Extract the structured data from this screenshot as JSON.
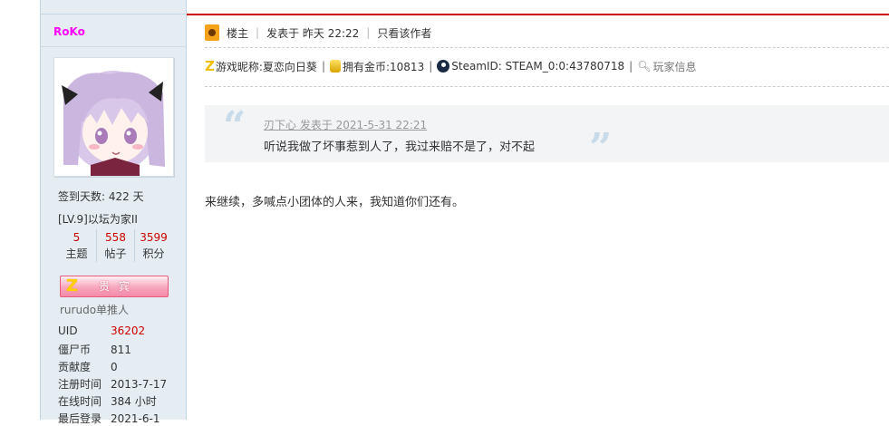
{
  "sidebar": {
    "username": "RoKo",
    "checkin": "签到天数: 422 天",
    "level": "[LV.9]以坛为家II",
    "stats": [
      {
        "value": "5",
        "label": "主题"
      },
      {
        "value": "558",
        "label": "帖子"
      },
      {
        "value": "3599",
        "label": "积分"
      }
    ],
    "badge_label": "贵宾",
    "group": "rurudo单推人",
    "fields": [
      {
        "key": "UID",
        "value": "36202"
      },
      {
        "key": "僵尸币",
        "value": "811"
      },
      {
        "key": "贡献度",
        "value": "0"
      },
      {
        "key": "注册时间",
        "value": "2013-7-17"
      },
      {
        "key": "在线时间",
        "value": "384 小时"
      },
      {
        "key": "最后登录",
        "value": "2021-6-1"
      }
    ]
  },
  "post": {
    "role": "楼主",
    "posted": "发表于 昨天 22:22",
    "only_author": "只看该作者",
    "game_nick": "游戏昵称:夏恋向日葵",
    "gold": "拥有金币:10813",
    "steam": "SteamID: STEAM_0:0:43780718",
    "player_info": "玩家信息",
    "quote_author": "刃下心 发表于 2021-5-31 22:21",
    "quote_text": "听说我做了坏事惹到人了，我过来赔不是了，对不起",
    "body": "来继续，多喊点小团体的人来，我知道你们还有。"
  },
  "colors": {
    "accent": "#cc0000",
    "username": "#ff00ff",
    "sidebar_bg": "#e5edf2"
  },
  "icons": [
    "crown-icon",
    "z-icon",
    "coin-icon",
    "steam-icon",
    "magnifier-icon",
    "quote-open-icon",
    "quote-close-icon"
  ]
}
